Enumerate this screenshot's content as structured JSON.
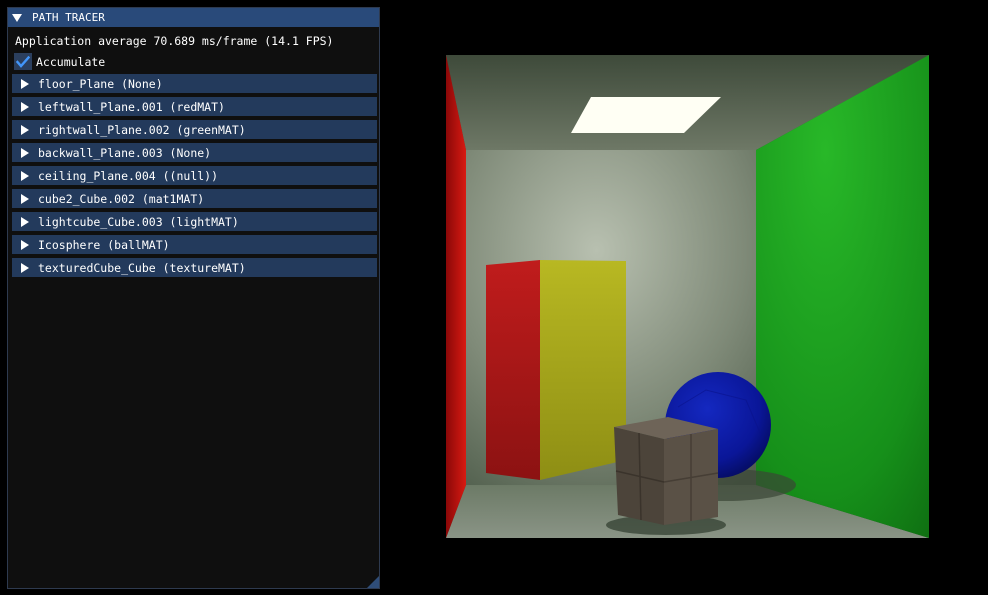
{
  "window": {
    "title": "PATH TRACER",
    "collapse_icon": "triangle-down-icon"
  },
  "stats": {
    "text": "Application average 70.689 ms/frame (14.1 FPS)"
  },
  "accumulate": {
    "label": "Accumulate",
    "checked": true
  },
  "objects": [
    {
      "label": "floor_Plane (None)"
    },
    {
      "label": "leftwall_Plane.001 (redMAT)"
    },
    {
      "label": "rightwall_Plane.002 (greenMAT)"
    },
    {
      "label": "backwall_Plane.003 (None)"
    },
    {
      "label": "ceiling_Plane.004 ((null))"
    },
    {
      "label": "cube2_Cube.002 (mat1MAT)"
    },
    {
      "label": "lightcube_Cube.003 (lightMAT)"
    },
    {
      "label": "Icosphere (ballMAT)"
    },
    {
      "label": "texturedCube_Cube (textureMAT)"
    }
  ],
  "colors": {
    "title_bar": "#294a7a",
    "tree_item_bg": "#233a5c",
    "panel_bg": "#0f0f0f",
    "checkmark": "#4296fa",
    "left_wall": "#c81010",
    "right_wall": "#1aa81a",
    "sphere": "#0a1aa0",
    "tall_box_front": "#a8a81a",
    "tall_box_side": "#b01818"
  }
}
